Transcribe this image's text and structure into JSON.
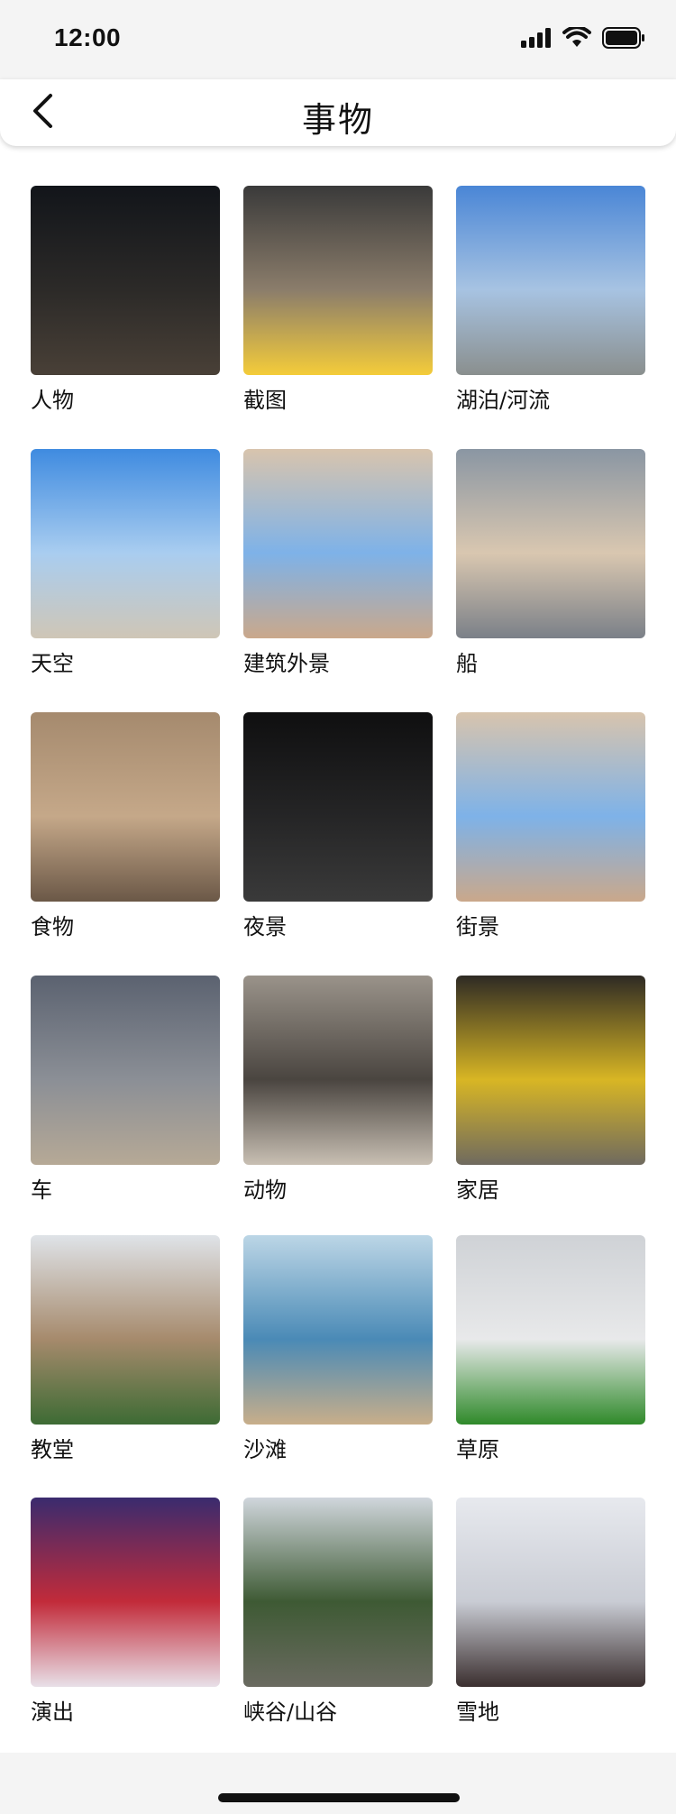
{
  "status_bar": {
    "time": "12:00"
  },
  "nav": {
    "title": "事物",
    "back_icon": "chevron-left-icon"
  },
  "categories": [
    {
      "label": "人物",
      "icon": "people-photo",
      "colors": [
        "#12151a",
        "#2c2a28",
        "#494037"
      ]
    },
    {
      "label": "截图",
      "icon": "screenshot-photo",
      "colors": [
        "#3a3a3a",
        "#8b7d6b",
        "#f4cc3a"
      ]
    },
    {
      "label": "湖泊/河流",
      "icon": "river-photo",
      "colors": [
        "#4a86d6",
        "#a7c3e2",
        "#8a8f8e"
      ]
    },
    {
      "label": "天空",
      "icon": "sky-photo",
      "colors": [
        "#3f8be0",
        "#a9cdf0",
        "#cfc6b6"
      ]
    },
    {
      "label": "建筑外景",
      "icon": "building-photo",
      "colors": [
        "#d8c4ad",
        "#7eb2e8",
        "#caa88b"
      ]
    },
    {
      "label": "船",
      "icon": "boat-photo",
      "colors": [
        "#8a96a3",
        "#d9c7b0",
        "#7b8088"
      ]
    },
    {
      "label": "食物",
      "icon": "food-photo",
      "colors": [
        "#a58a6e",
        "#c5a889",
        "#6b5847"
      ]
    },
    {
      "label": "夜景",
      "icon": "night-photo",
      "colors": [
        "#0f0f10",
        "#252526",
        "#3a3a3a"
      ]
    },
    {
      "label": "街景",
      "icon": "street-photo",
      "colors": [
        "#d8c4ad",
        "#7eb2e8",
        "#caa88b"
      ]
    },
    {
      "label": "车",
      "icon": "car-photo",
      "colors": [
        "#5b6270",
        "#8b8f96",
        "#b6a996"
      ]
    },
    {
      "label": "动物",
      "icon": "animal-photo",
      "colors": [
        "#9a938a",
        "#4a4540",
        "#c8bfb3"
      ]
    },
    {
      "label": "家居",
      "icon": "home-photo",
      "colors": [
        "#2e2a24",
        "#d8b624",
        "#6f6a5f"
      ]
    },
    {
      "label": "教堂",
      "icon": "church-photo",
      "colors": [
        "#dfe3e8",
        "#a68a6c",
        "#3d6b34"
      ]
    },
    {
      "label": "沙滩",
      "icon": "beach-photo",
      "colors": [
        "#bcd6e6",
        "#4a8ab6",
        "#c8ae8a"
      ]
    },
    {
      "label": "草原",
      "icon": "grassland-photo",
      "colors": [
        "#cfd2d6",
        "#e8e9ea",
        "#2f8a2a"
      ]
    },
    {
      "label": "演出",
      "icon": "performance-photo",
      "colors": [
        "#3a2b6e",
        "#c22b3a",
        "#e8e0e8"
      ]
    },
    {
      "label": "峡谷/山谷",
      "icon": "canyon-photo",
      "colors": [
        "#d0d6dc",
        "#3e5a34",
        "#6a6a60"
      ]
    },
    {
      "label": "雪地",
      "icon": "snow-photo",
      "colors": [
        "#e7e9ee",
        "#c9ccd4",
        "#3b2f2f"
      ]
    }
  ]
}
